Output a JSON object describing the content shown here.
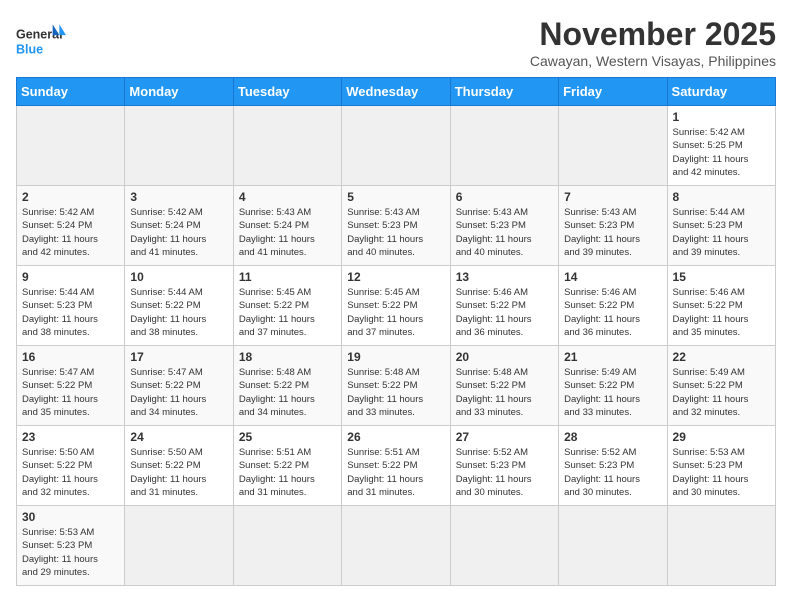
{
  "header": {
    "logo_general": "General",
    "logo_blue": "Blue",
    "month_title": "November 2025",
    "subtitle": "Cawayan, Western Visayas, Philippines"
  },
  "days_of_week": [
    "Sunday",
    "Monday",
    "Tuesday",
    "Wednesday",
    "Thursday",
    "Friday",
    "Saturday"
  ],
  "weeks": [
    [
      {
        "day": null,
        "info": null
      },
      {
        "day": null,
        "info": null
      },
      {
        "day": null,
        "info": null
      },
      {
        "day": null,
        "info": null
      },
      {
        "day": null,
        "info": null
      },
      {
        "day": null,
        "info": null
      },
      {
        "day": "1",
        "info": "Sunrise: 5:42 AM\nSunset: 5:25 PM\nDaylight: 11 hours\nand 42 minutes."
      }
    ],
    [
      {
        "day": "2",
        "info": "Sunrise: 5:42 AM\nSunset: 5:24 PM\nDaylight: 11 hours\nand 42 minutes."
      },
      {
        "day": "3",
        "info": "Sunrise: 5:42 AM\nSunset: 5:24 PM\nDaylight: 11 hours\nand 41 minutes."
      },
      {
        "day": "4",
        "info": "Sunrise: 5:43 AM\nSunset: 5:24 PM\nDaylight: 11 hours\nand 41 minutes."
      },
      {
        "day": "5",
        "info": "Sunrise: 5:43 AM\nSunset: 5:23 PM\nDaylight: 11 hours\nand 40 minutes."
      },
      {
        "day": "6",
        "info": "Sunrise: 5:43 AM\nSunset: 5:23 PM\nDaylight: 11 hours\nand 40 minutes."
      },
      {
        "day": "7",
        "info": "Sunrise: 5:43 AM\nSunset: 5:23 PM\nDaylight: 11 hours\nand 39 minutes."
      },
      {
        "day": "8",
        "info": "Sunrise: 5:44 AM\nSunset: 5:23 PM\nDaylight: 11 hours\nand 39 minutes."
      }
    ],
    [
      {
        "day": "9",
        "info": "Sunrise: 5:44 AM\nSunset: 5:23 PM\nDaylight: 11 hours\nand 38 minutes."
      },
      {
        "day": "10",
        "info": "Sunrise: 5:44 AM\nSunset: 5:22 PM\nDaylight: 11 hours\nand 38 minutes."
      },
      {
        "day": "11",
        "info": "Sunrise: 5:45 AM\nSunset: 5:22 PM\nDaylight: 11 hours\nand 37 minutes."
      },
      {
        "day": "12",
        "info": "Sunrise: 5:45 AM\nSunset: 5:22 PM\nDaylight: 11 hours\nand 37 minutes."
      },
      {
        "day": "13",
        "info": "Sunrise: 5:46 AM\nSunset: 5:22 PM\nDaylight: 11 hours\nand 36 minutes."
      },
      {
        "day": "14",
        "info": "Sunrise: 5:46 AM\nSunset: 5:22 PM\nDaylight: 11 hours\nand 36 minutes."
      },
      {
        "day": "15",
        "info": "Sunrise: 5:46 AM\nSunset: 5:22 PM\nDaylight: 11 hours\nand 35 minutes."
      }
    ],
    [
      {
        "day": "16",
        "info": "Sunrise: 5:47 AM\nSunset: 5:22 PM\nDaylight: 11 hours\nand 35 minutes."
      },
      {
        "day": "17",
        "info": "Sunrise: 5:47 AM\nSunset: 5:22 PM\nDaylight: 11 hours\nand 34 minutes."
      },
      {
        "day": "18",
        "info": "Sunrise: 5:48 AM\nSunset: 5:22 PM\nDaylight: 11 hours\nand 34 minutes."
      },
      {
        "day": "19",
        "info": "Sunrise: 5:48 AM\nSunset: 5:22 PM\nDaylight: 11 hours\nand 33 minutes."
      },
      {
        "day": "20",
        "info": "Sunrise: 5:48 AM\nSunset: 5:22 PM\nDaylight: 11 hours\nand 33 minutes."
      },
      {
        "day": "21",
        "info": "Sunrise: 5:49 AM\nSunset: 5:22 PM\nDaylight: 11 hours\nand 33 minutes."
      },
      {
        "day": "22",
        "info": "Sunrise: 5:49 AM\nSunset: 5:22 PM\nDaylight: 11 hours\nand 32 minutes."
      }
    ],
    [
      {
        "day": "23",
        "info": "Sunrise: 5:50 AM\nSunset: 5:22 PM\nDaylight: 11 hours\nand 32 minutes."
      },
      {
        "day": "24",
        "info": "Sunrise: 5:50 AM\nSunset: 5:22 PM\nDaylight: 11 hours\nand 31 minutes."
      },
      {
        "day": "25",
        "info": "Sunrise: 5:51 AM\nSunset: 5:22 PM\nDaylight: 11 hours\nand 31 minutes."
      },
      {
        "day": "26",
        "info": "Sunrise: 5:51 AM\nSunset: 5:22 PM\nDaylight: 11 hours\nand 31 minutes."
      },
      {
        "day": "27",
        "info": "Sunrise: 5:52 AM\nSunset: 5:23 PM\nDaylight: 11 hours\nand 30 minutes."
      },
      {
        "day": "28",
        "info": "Sunrise: 5:52 AM\nSunset: 5:23 PM\nDaylight: 11 hours\nand 30 minutes."
      },
      {
        "day": "29",
        "info": "Sunrise: 5:53 AM\nSunset: 5:23 PM\nDaylight: 11 hours\nand 30 minutes."
      }
    ],
    [
      {
        "day": "30",
        "info": "Sunrise: 5:53 AM\nSunset: 5:23 PM\nDaylight: 11 hours\nand 29 minutes."
      },
      {
        "day": null,
        "info": null
      },
      {
        "day": null,
        "info": null
      },
      {
        "day": null,
        "info": null
      },
      {
        "day": null,
        "info": null
      },
      {
        "day": null,
        "info": null
      },
      {
        "day": null,
        "info": null
      }
    ]
  ]
}
